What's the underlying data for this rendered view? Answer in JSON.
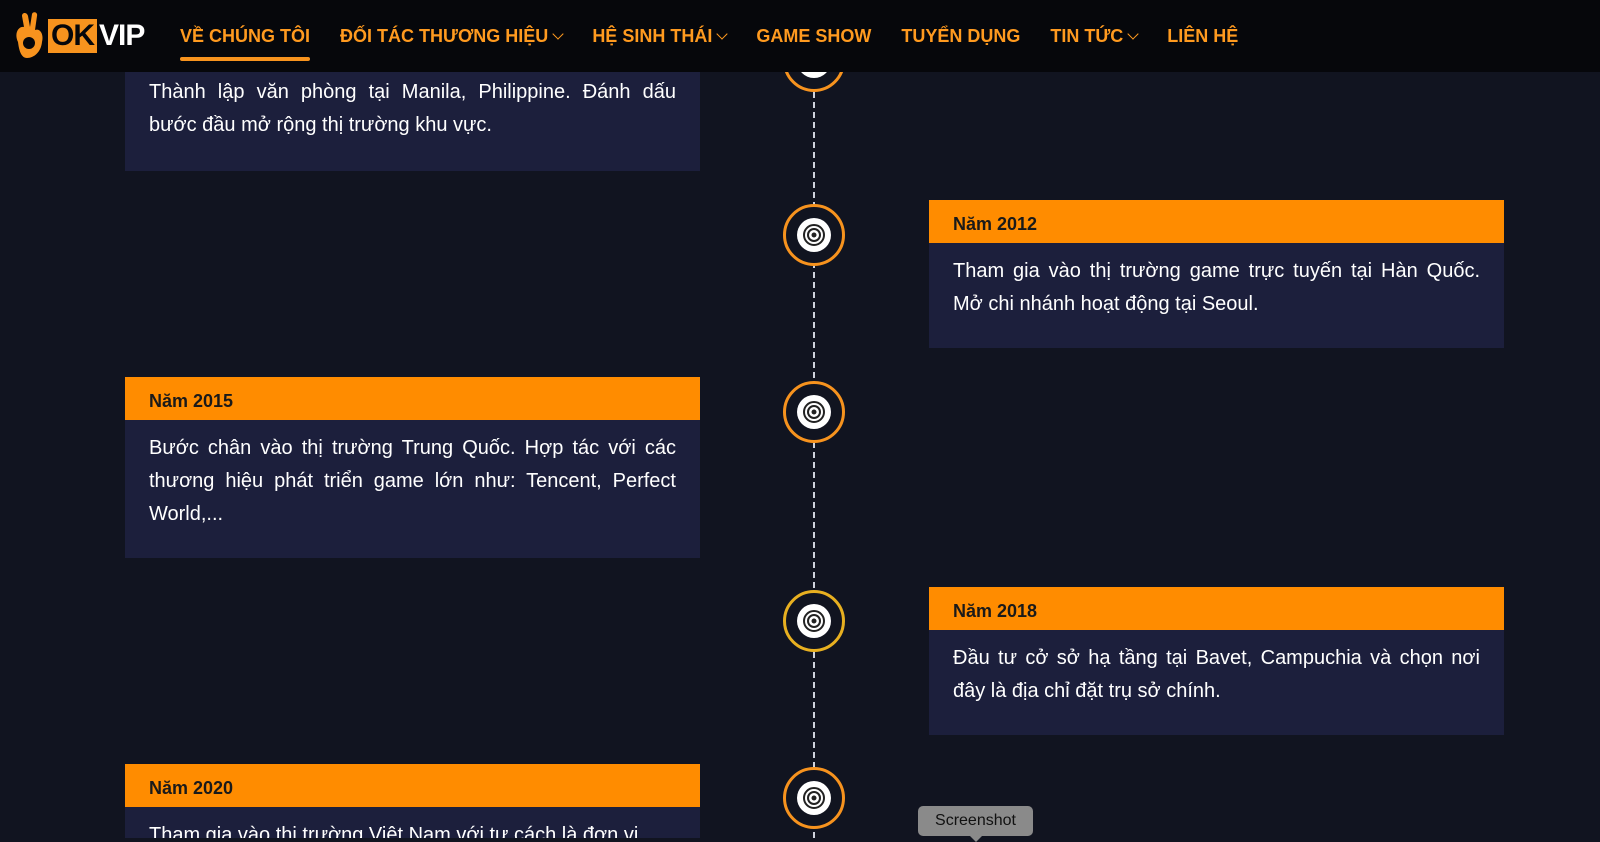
{
  "brand": {
    "logo_ok": "OK",
    "logo_vip": "VIP",
    "accent": "#f7931e",
    "nav_text_color": "#ff9a1f",
    "card_header_color": "#ff8c00",
    "card_body_color": "#1c1f3c",
    "page_background": "#111420"
  },
  "nav": {
    "items": [
      {
        "label": "VỀ CHÚNG TÔI",
        "dropdown": false,
        "active": true
      },
      {
        "label": "ĐỐI TÁC THƯƠNG HIỆU",
        "dropdown": true,
        "active": false
      },
      {
        "label": "HỆ SINH THÁI",
        "dropdown": true,
        "active": false
      },
      {
        "label": "GAME SHOW",
        "dropdown": false,
        "active": false
      },
      {
        "label": "TUYỂN DỤNG",
        "dropdown": false,
        "active": false
      },
      {
        "label": "TIN TỨC",
        "dropdown": true,
        "active": false
      },
      {
        "label": "LIÊN HỆ",
        "dropdown": false,
        "active": false
      }
    ]
  },
  "timeline": {
    "events": [
      {
        "year": "",
        "text": "Thành lập văn phòng tại Manila, Philippine. Đánh dấu bước đầu mở rộng thị trường khu vực."
      },
      {
        "year": "Năm 2012",
        "text": "Tham gia vào thị trường game trực tuyến tại Hàn Quốc. Mở chi nhánh hoạt động tại Seoul."
      },
      {
        "year": "Năm 2015",
        "text": "Bước chân vào thị trường Trung Quốc. Hợp tác với các thương hiệu phát triển game lớn như: Tencent, Perfect World,..."
      },
      {
        "year": "Năm 2018",
        "text": "Đầu tư cở sở hạ tầng tại Bavet, Campuchia và chọn nơi đây là địa chỉ đặt trụ sở chính."
      },
      {
        "year": "Năm 2020",
        "text": "Tham gia vào thị trường Việt Nam với tư cách là đơn vị"
      }
    ]
  },
  "tooltip": {
    "label": "Screenshot"
  }
}
